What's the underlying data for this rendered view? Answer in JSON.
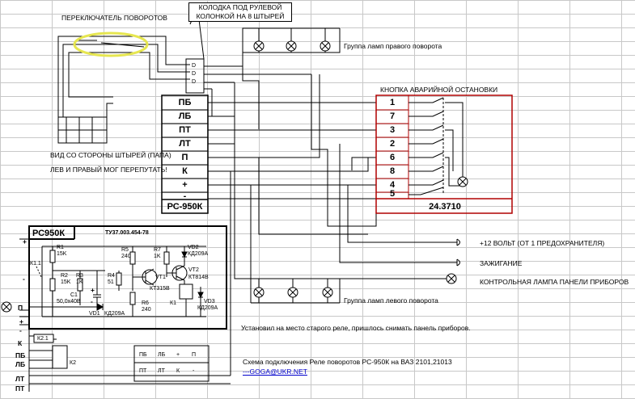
{
  "switch_title": "ПЕРЕКЛЮЧАТЕЛЬ ПОВОРОТОВ",
  "connector_callout": [
    "КОЛОДКА ПОД РУЛЕВОЙ",
    "КОЛОНКОЙ НА 8 ШТЫРЕЙ"
  ],
  "connector_pins": [
    "D",
    "D",
    "D"
  ],
  "right_lamps_label": "Группа ламп правого поворота",
  "left_lamps_label": "Группа ламп левого поворота",
  "relay_pins": [
    "ПБ",
    "ЛБ",
    "ПТ",
    "ЛТ",
    "П",
    "К",
    "+",
    "-"
  ],
  "relay_name": "РС-950К",
  "hazard_title": "КНОПКА АВАРИЙНОЙ ОСТАНОВКИ",
  "hazard_pins": [
    "1",
    "7",
    "3",
    "2",
    "6",
    "8",
    "4",
    "5"
  ],
  "hazard_part": "24.3710",
  "pin_view_note": "ВИД СО СТОРОНЫ ШТЫРЕЙ (ПАПА)",
  "swap_note": "ЛЕВ И ПРАВЫЙ МОГ ПЕРЕПУТАТЬ!",
  "plus12_label": "+12 ВОЛЬТ (ОТ 1 ПРЕДОХРАНИТЕЛЯ)",
  "ignition_label": "ЗАЖИГАНИЕ",
  "panel_lamp_label": "КОНТРОЛЬНАЯ ЛАМПА ПАНЕЛИ ПРИБОРОВ",
  "replaced_note": "Установил на место старого реле, пришлось снимать панель приборов.",
  "caption": "Схема подключения Реле поворотов РС-950К на ВАЗ 2101,21013",
  "author_link": "---GOGA@UKR.NET",
  "schematic": {
    "title": "РС950К",
    "spec": "ТУ37.003.454-78",
    "R1": "R1",
    "R1v": "15K",
    "R2": "R2",
    "R2v": "15K",
    "R3": "R3",
    "R3v": "1K",
    "R4": "R4",
    "R4v": "51",
    "R5": "R5",
    "R5v": "240",
    "R6": "R6",
    "R6v": "240",
    "R7": "R7",
    "R7v": "1K",
    "C1": "C1",
    "C1v": "50,0х40В",
    "VD1": "VD1",
    "VD1v": "КД209А",
    "VD2": "VD2",
    "VD2v": "КД209А",
    "VD3": "VD3",
    "VD3v": "КД209А",
    "VT1": "VT1",
    "VT1v": "КТ315В",
    "VT2": "VT2",
    "VT2v": "КТ814В",
    "K1": "К1",
    "K11": "К1.1",
    "K2": "К2",
    "K21": "К2.1",
    "term_labels": [
      "П",
      "+",
      "-",
      "К",
      "ПБ",
      "ЛБ",
      "ЛТ",
      "ПТ"
    ],
    "terminal_marks": [
      "+",
      "-",
      "+",
      "-"
    ]
  },
  "mini_top": [
    "ПБ",
    "ЛБ",
    "+",
    "П"
  ],
  "mini_bottom": [
    "ПТ",
    "ЛТ",
    "К",
    "-"
  ]
}
